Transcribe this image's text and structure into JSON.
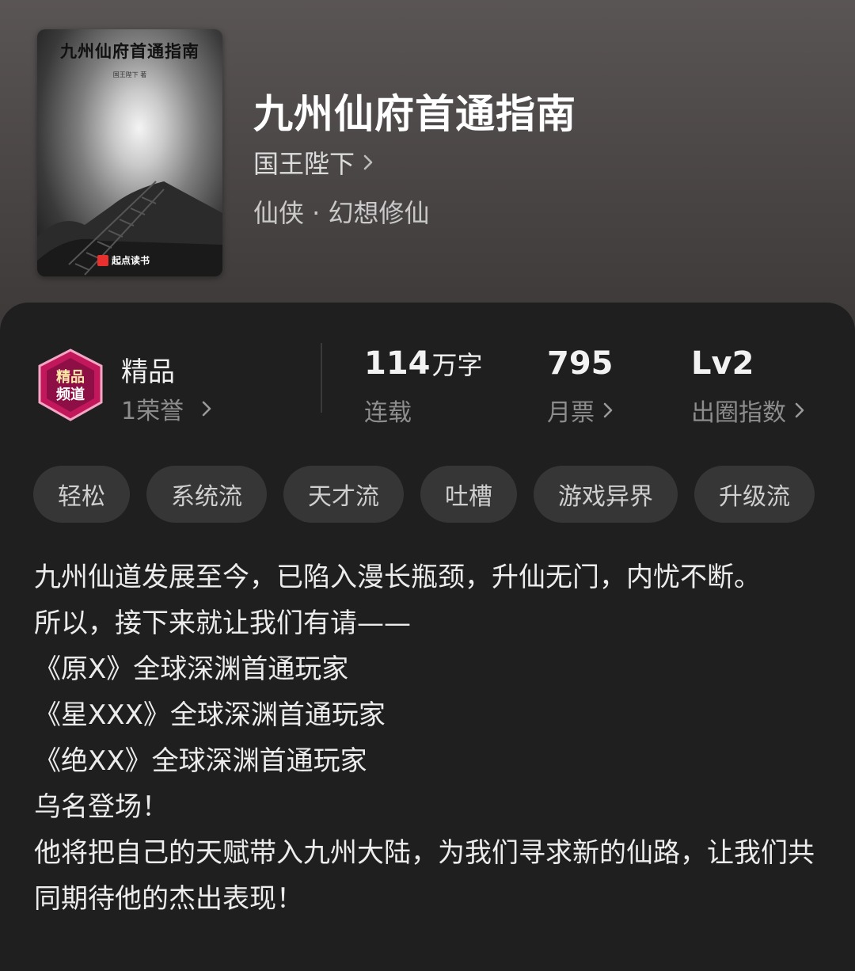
{
  "book": {
    "title": "九州仙府首通指南",
    "author": "国王陛下",
    "genre": "仙侠 · 幻想修仙"
  },
  "cover": {
    "title": "九州仙府首通指南",
    "author_line": "国王陛下 著",
    "brand": "起点读书"
  },
  "badge": {
    "title": "精品",
    "honor": "1荣誉"
  },
  "stats": [
    {
      "value": "114",
      "unit": "万字",
      "label": "连载"
    },
    {
      "value": "795",
      "unit": "",
      "label": "月票"
    },
    {
      "value": "Lv2",
      "unit": "",
      "label": "出圈指数"
    }
  ],
  "tags": [
    "轻松",
    "系统流",
    "天才流",
    "吐槽",
    "游戏异界",
    "升级流"
  ],
  "synopsis": [
    "九州仙道发展至今，已陷入漫长瓶颈，升仙无门，内忧不断。",
    "所以，接下来就让我们有请——",
    "《原X》全球深渊首通玩家",
    "《星XXX》全球深渊首通玩家",
    "《绝XX》全球深渊首通玩家",
    "乌名登场！",
    "他将把自己的天赋带入九州大陆，为我们寻求新的仙路，让我们共同期待他的杰出表现！"
  ],
  "colors": {
    "accent_badge": "#c2185b",
    "panel_bg": "#1f1f1f",
    "tag_bg": "#363636"
  }
}
